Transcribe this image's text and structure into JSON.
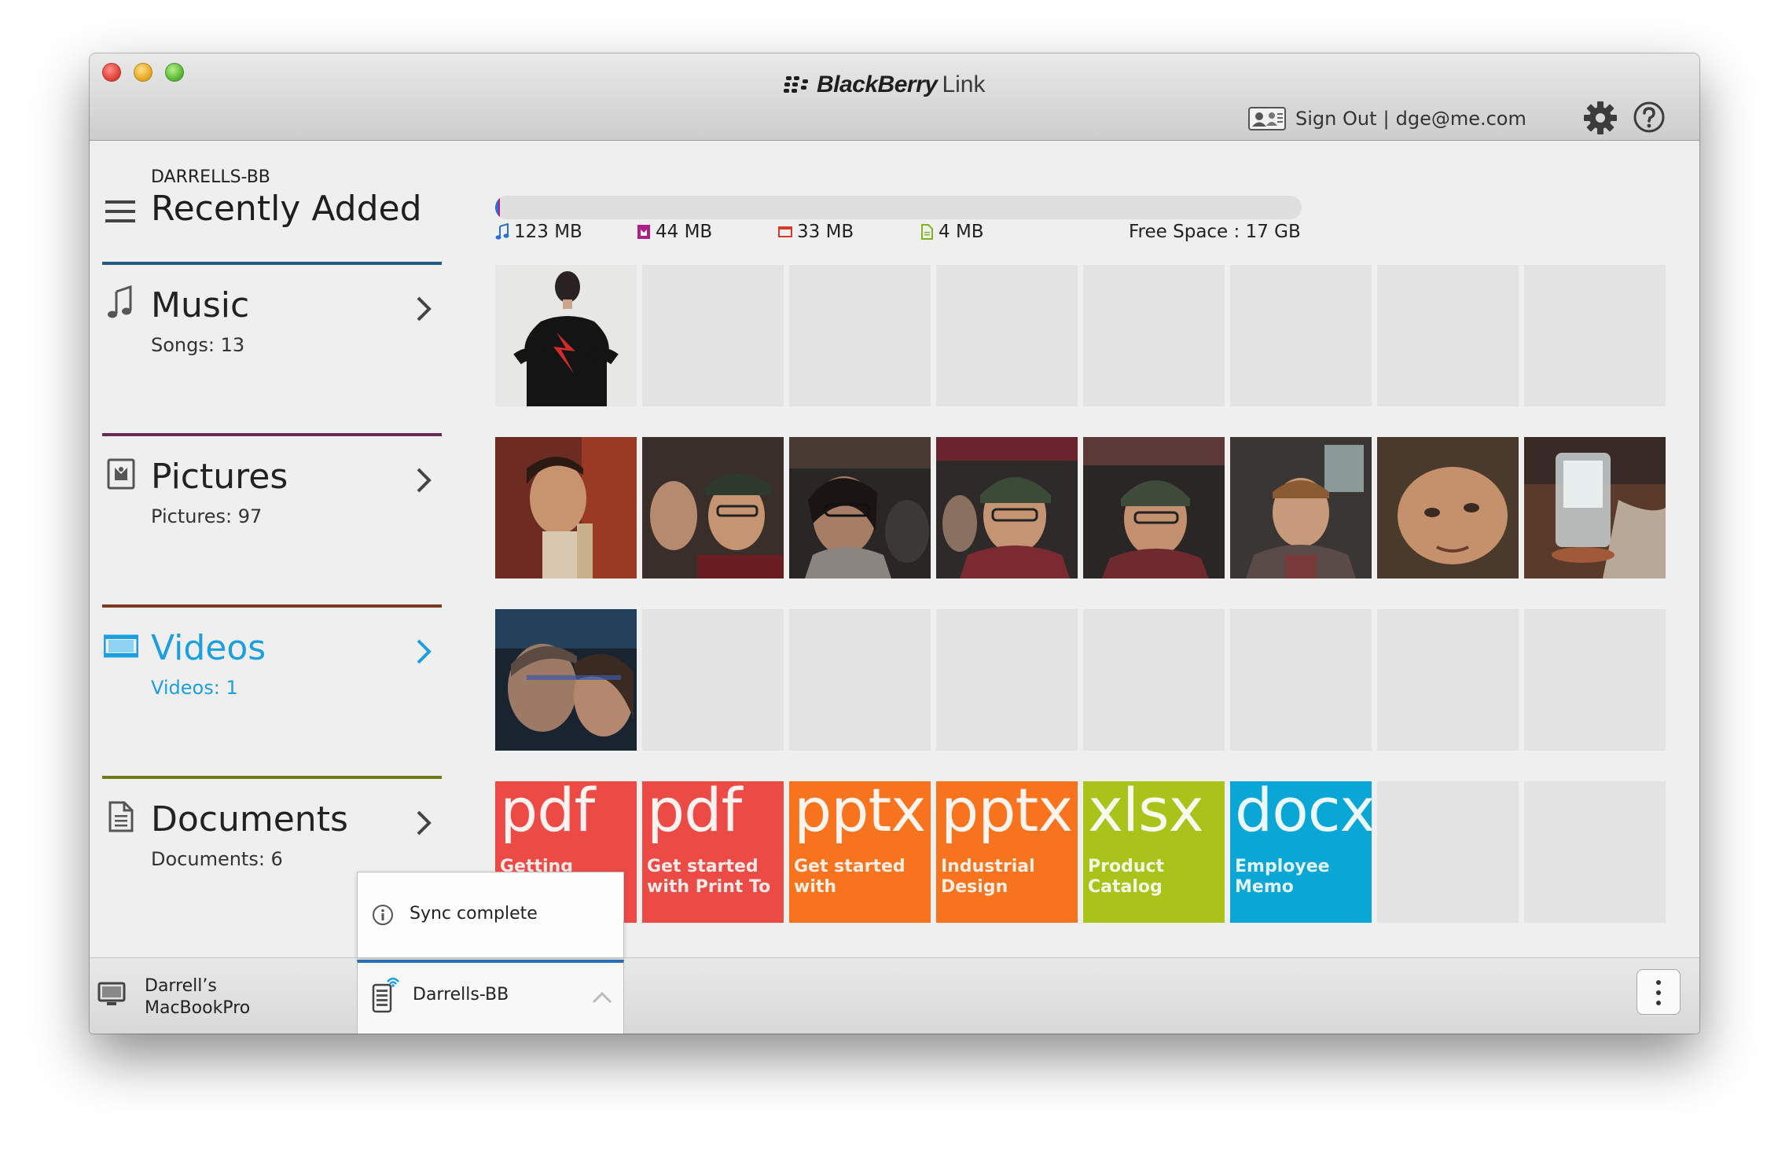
{
  "window": {
    "brand": "BlackBerry",
    "product": "Link",
    "account": {
      "sign_out_label": "Sign Out",
      "separator": "|",
      "email": "dge@me.com"
    }
  },
  "sidebar": {
    "device_name": "DARRELLS-BB",
    "title": "Recently Added",
    "categories": [
      {
        "title": "Music",
        "count": "Songs: 13",
        "accent": "#1f5a86"
      },
      {
        "title": "Pictures",
        "count": "Pictures: 97",
        "accent": "#6b2a56"
      },
      {
        "title": "Videos",
        "count": "Videos: 1",
        "accent": "#7a3a20"
      },
      {
        "title": "Documents",
        "count": "Documents: 6",
        "accent": "#6e7a12"
      }
    ]
  },
  "storage": {
    "items": [
      {
        "label": "123 MB",
        "icon": "music-note-icon",
        "color": "#2a6fd1"
      },
      {
        "label": "44 MB",
        "icon": "pictures-icon",
        "color": "#b01f86"
      },
      {
        "label": "33 MB",
        "icon": "video-icon",
        "color": "#d63a2a"
      },
      {
        "label": "4 MB",
        "icon": "document-icon",
        "color": "#7fb522"
      }
    ],
    "free_space": "Free Space : 17 GB"
  },
  "documents": [
    {
      "ext": "pdf",
      "name": "Getting",
      "color": "#ec4b45"
    },
    {
      "ext": "pdf",
      "name": "Get started with Print To",
      "color": "#ec4b45"
    },
    {
      "ext": "pptx",
      "name": "Get started with",
      "color": "#f7731d"
    },
    {
      "ext": "pptx",
      "name": "Industrial Design",
      "color": "#f7731d"
    },
    {
      "ext": "xlsx",
      "name": "Product Catalog",
      "color": "#a9c31b"
    },
    {
      "ext": "docx",
      "name": "Employee Memo",
      "color": "#0aa6d6"
    }
  ],
  "bottombar": {
    "computer_name": "Darrell’s MacBookPro",
    "device_tab": "Darrells-BB",
    "sync_status": "Sync complete"
  }
}
